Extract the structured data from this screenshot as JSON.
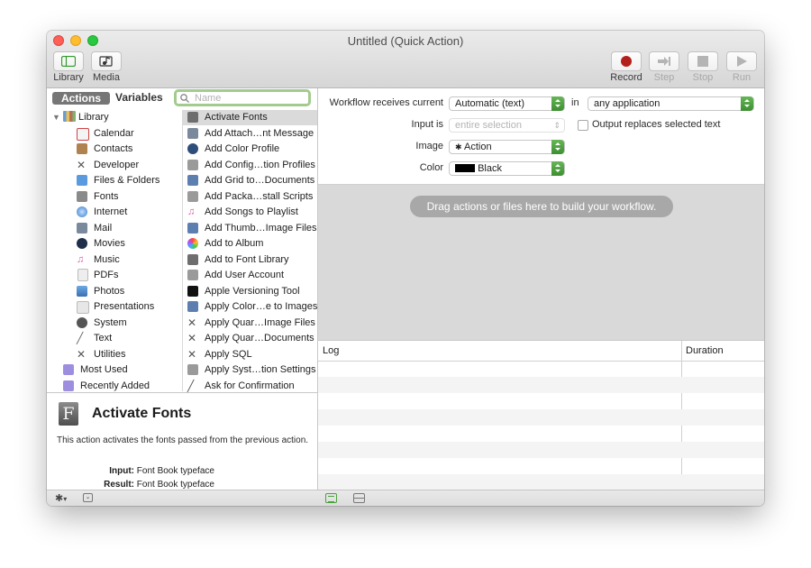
{
  "window": {
    "title": "Untitled (Quick Action)"
  },
  "toolbar": {
    "library": "Library",
    "media": "Media",
    "record": "Record",
    "step": "Step",
    "stop": "Stop",
    "run": "Run"
  },
  "library_pane": {
    "segments": {
      "actions": "Actions",
      "variables": "Variables"
    },
    "search_placeholder": "Name",
    "root": "Library",
    "categories": [
      "Calendar",
      "Contacts",
      "Developer",
      "Files & Folders",
      "Fonts",
      "Internet",
      "Mail",
      "Movies",
      "Music",
      "PDFs",
      "Photos",
      "Presentations",
      "System",
      "Text",
      "Utilities"
    ],
    "special": [
      "Most Used",
      "Recently Added"
    ]
  },
  "actions_list": [
    "Activate Fonts",
    "Add Attach…nt Message",
    "Add Color Profile",
    "Add Config…tion Profiles",
    "Add Grid to…Documents",
    "Add Packa…stall Scripts",
    "Add Songs to Playlist",
    "Add Thumb…Image Files",
    "Add to Album",
    "Add to Font Library",
    "Add User Account",
    "Apple Versioning Tool",
    "Apply Color…e to Images",
    "Apply Quar…Image Files",
    "Apply Quar…Documents",
    "Apply SQL",
    "Apply Syst…tion Settings",
    "Ask for Confirmation"
  ],
  "description": {
    "title": "Activate Fonts",
    "text": "This action activates the fonts passed from the previous action.",
    "input_label": "Input:",
    "input_value": "Font Book typeface",
    "result_label": "Result:",
    "result_value": "Font Book typeface"
  },
  "workflow_config": {
    "receives_label": "Workflow receives current",
    "receives_value": "Automatic (text)",
    "in_label": "in",
    "in_value": "any application",
    "input_is_label": "Input is",
    "input_is_value": "entire selection",
    "output_replaces_label": "Output replaces selected text",
    "image_label": "Image",
    "image_value": "Action",
    "color_label": "Color",
    "color_value": "Black"
  },
  "canvas": {
    "hint": "Drag actions or files here to build your workflow."
  },
  "log": {
    "col_log": "Log",
    "col_duration": "Duration"
  },
  "colors": {
    "record": "#b3201b",
    "accent_green": "#4aa23d",
    "search_ring": "#a3cb8d"
  }
}
